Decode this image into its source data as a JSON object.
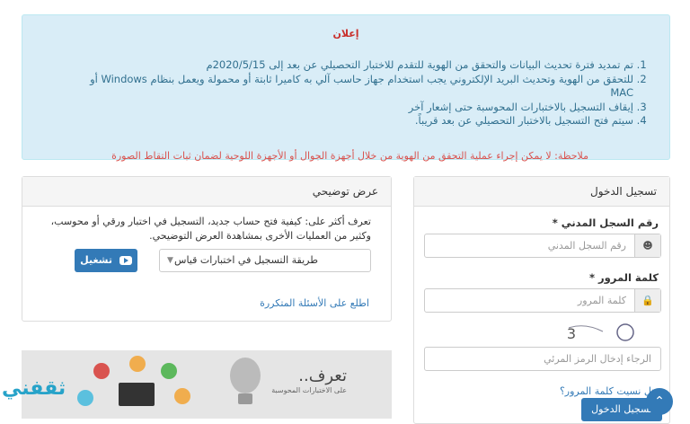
{
  "notice": {
    "title": "إعلان",
    "items": [
      "تم تمديد فترة تحديث البيانات والتحقق من الهوية للتقدم للاختبار التحصيلي عن بعد إلى 2020/5/15م",
      "للتحقق من الهوية وتحديث البريد الإلكتروني يجب استخدام جهاز حاسب آلي به كاميرا ثابتة أو محمولة ويعمل بنظام Windows أو MAC",
      "إيقاف التسجيل بالاختبارات المحوسبة حتى إشعار آخر",
      "سيتم فتح التسجيل بالاختبار التحصيلي عن بعد قريباً."
    ],
    "note": "ملاحظة: لا يمكن إجراء عملية التحقق من الهوية من خلال أجهزة الجوال أو الأجهزة اللوحية لضمان ثبات التقاط الصورة"
  },
  "demo": {
    "header": "عرض توضيحي",
    "description": "تعرف أكثر على: كيفية فتح حساب جديد، التسجيل في اختبار ورقي أو محوسب، وكثير من العمليات الأخرى بمشاهدة العرض التوضيحي.",
    "select_value": "طريقة التسجيل في اختبارات قياس",
    "play_label": "تشغيل",
    "faq_link": "اطلع على الأسئلة المتكررة"
  },
  "banner": {
    "title": "تعرف..",
    "subtitle": "على الاختبارات المحوسبة"
  },
  "logo": "ثقفني",
  "login": {
    "header": "تسجيل الدخول",
    "id_label": "رقم السجل المدني",
    "id_placeholder": "رقم السجل المدني",
    "password_label": "كلمة المرور",
    "password_placeholder": "كلمة المرور",
    "required_mark": "*",
    "captcha_text": "2613",
    "captcha_placeholder": "الرجاء إدخال الرمز المرئي",
    "forgot_link": "هل نسيت كلمة المرور؟",
    "submit_label": "تسجيل الدخول"
  },
  "colors": {
    "primary": "#337ab7",
    "notice_bg": "#d9edf7",
    "alert": "#d9534f"
  }
}
